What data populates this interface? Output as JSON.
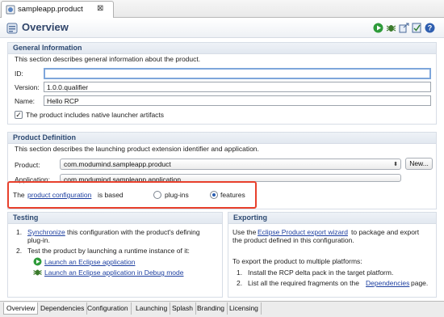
{
  "editor_tab": {
    "title": "sampleapp.product",
    "close_glyph": "⊠"
  },
  "header": {
    "title": "Overview",
    "actions": [
      {
        "name": "run-icon",
        "color": "#2e9b3a"
      },
      {
        "name": "debug-icon",
        "color": "#3b7a2b"
      },
      {
        "name": "export-icon",
        "color": "#4a6a9a"
      },
      {
        "name": "validate-icon",
        "color": "#4a6a9a"
      },
      {
        "name": "help-icon",
        "color": "#2f5fb0"
      }
    ]
  },
  "general_info": {
    "title": "General Information",
    "description": "This section describes general information about the product.",
    "id_label": "ID:",
    "id_value": "",
    "version_label": "Version:",
    "version_value": "1.0.0.qualifier",
    "name_label": "Name:",
    "name_value": "Hello RCP",
    "launcher_checkbox_label": "The product includes native launcher artifacts",
    "launcher_checked": true,
    "check_glyph": "✓"
  },
  "product_definition": {
    "title": "Product Definition",
    "description": "This section describes the launching product extension identifier and application.",
    "product_label": "Product:",
    "product_value": "com.modumind.sampleapp.product",
    "new_button": "New...",
    "application_label": "Application:",
    "application_value": "com.modumind.sampleapp.application",
    "config_prefix": "The",
    "config_link": "product configuration",
    "config_suffix": "is based",
    "option_plugins": "plug-ins",
    "option_features": "features",
    "selected_option": "features",
    "combo_arrow": "⬍"
  },
  "testing": {
    "title": "Testing",
    "step1_num": "1.",
    "step1_link": "Synchronize",
    "step1_text": "this configuration with the product's defining",
    "step1_text2": "plug-in.",
    "step2_num": "2.",
    "step2_text": "Test the product by launching a runtime instance of it:",
    "launch_link": "Launch an Eclipse application",
    "debug_link": "Launch an Eclipse application in Debug mode"
  },
  "exporting": {
    "title": "Exporting",
    "line1_prefix": "Use the",
    "line1_link": "Eclipse Product export wizard",
    "line1_suffix": "to package and export",
    "line2": "the product defined in this configuration.",
    "line3": "To export the product to multiple platforms:",
    "step1_num": "1.",
    "step1_text": "Install the RCP delta pack in the target platform.",
    "step2_num": "2.",
    "step2_text": "List all the required fragments on the",
    "step2_link": "Dependencies",
    "step2_suffix": "page."
  },
  "bottom_tabs": [
    "Overview",
    "Dependencies",
    "Configuration",
    "Launching",
    "Splash",
    "Branding",
    "Licensing"
  ],
  "active_bottom_tab": "Overview"
}
